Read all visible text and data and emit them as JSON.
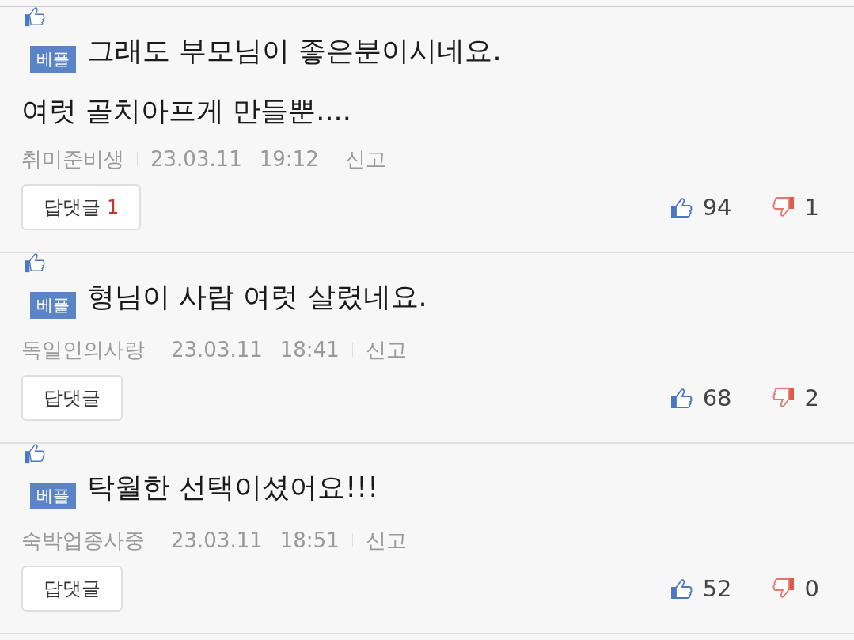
{
  "comments": [
    {
      "badge": "베플",
      "text": "그래도 부모님이 좋은분이시네요.",
      "more_lines": [
        "여럿 골치아프게 만들뿐...."
      ],
      "author": "취미준비생",
      "date": "23.03.11",
      "time": "19:12",
      "report": "신고",
      "reply_label": "답댓글",
      "reply_count": "1",
      "likes": "94",
      "dislikes": "1"
    },
    {
      "badge": "베플",
      "text": "형님이 사람 여럿 살렸네요.",
      "author": "독일인의사랑",
      "date": "23.03.11",
      "time": "18:41",
      "report": "신고",
      "reply_label": "답댓글",
      "likes": "68",
      "dislikes": "2"
    },
    {
      "badge": "베플",
      "text": "탁월한 선택이셨어요!!!",
      "author": "숙박업종사중",
      "date": "23.03.11",
      "time": "18:51",
      "report": "신고",
      "reply_label": "답댓글",
      "likes": "52",
      "dislikes": "0"
    }
  ]
}
